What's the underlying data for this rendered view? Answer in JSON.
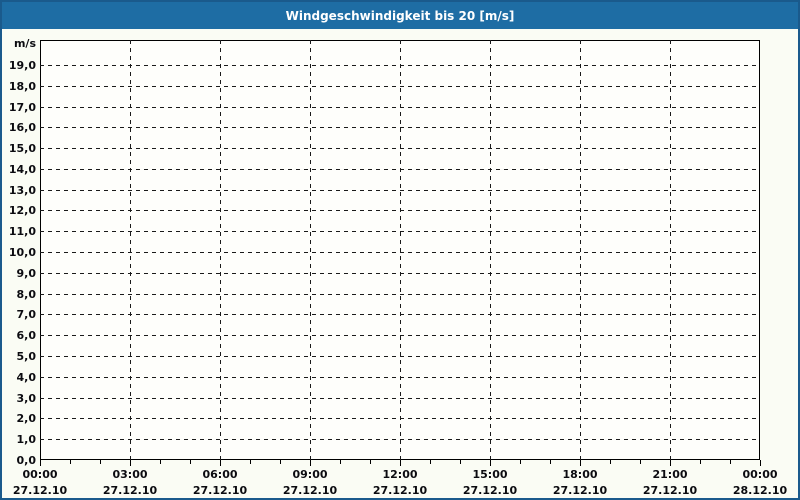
{
  "window": {
    "title": "Windgeschwindigkeit bis 20 [m/s]"
  },
  "colors": {
    "header_bg": "#1E6DA4",
    "frame_border": "#1A5A8C",
    "page_bg": "#FAFCF4",
    "plot_bg": "#FEFEFB",
    "grid": "#1A1A1A",
    "text": "#0B0B10",
    "title_text": "#FFFFFF"
  },
  "chart_data": {
    "type": "line",
    "title": "Windgeschwindigkeit bis 20 [m/s]",
    "xlabel": "",
    "ylabel": "m/s",
    "ylim": [
      0,
      20.2
    ],
    "xlim_hours": [
      0,
      24
    ],
    "grid": true,
    "legend": false,
    "series": [],
    "y_ticks": [
      {
        "value": 0,
        "label": "0,0"
      },
      {
        "value": 1,
        "label": "1,0"
      },
      {
        "value": 2,
        "label": "2,0"
      },
      {
        "value": 3,
        "label": "3,0"
      },
      {
        "value": 4,
        "label": "4,0"
      },
      {
        "value": 5,
        "label": "5,0"
      },
      {
        "value": 6,
        "label": "6,0"
      },
      {
        "value": 7,
        "label": "7,0"
      },
      {
        "value": 8,
        "label": "8,0"
      },
      {
        "value": 9,
        "label": "9,0"
      },
      {
        "value": 10,
        "label": "10,0"
      },
      {
        "value": 11,
        "label": "11,0"
      },
      {
        "value": 12,
        "label": "12,0"
      },
      {
        "value": 13,
        "label": "13,0"
      },
      {
        "value": 14,
        "label": "14,0"
      },
      {
        "value": 15,
        "label": "15,0"
      },
      {
        "value": 16,
        "label": "16,0"
      },
      {
        "value": 17,
        "label": "17,0"
      },
      {
        "value": 18,
        "label": "18,0"
      },
      {
        "value": 19,
        "label": "19,0"
      }
    ],
    "x_ticks": [
      {
        "hour": 0,
        "time": "00:00",
        "date": "27.12.10"
      },
      {
        "hour": 3,
        "time": "03:00",
        "date": "27.12.10"
      },
      {
        "hour": 6,
        "time": "06:00",
        "date": "27.12.10"
      },
      {
        "hour": 9,
        "time": "09:00",
        "date": "27.12.10"
      },
      {
        "hour": 12,
        "time": "12:00",
        "date": "27.12.10"
      },
      {
        "hour": 15,
        "time": "15:00",
        "date": "27.12.10"
      },
      {
        "hour": 18,
        "time": "18:00",
        "date": "27.12.10"
      },
      {
        "hour": 21,
        "time": "21:00",
        "date": "27.12.10"
      },
      {
        "hour": 24,
        "time": "00:00",
        "date": "28.12.10"
      }
    ],
    "minor_x_tick_interval_hours": 1
  }
}
